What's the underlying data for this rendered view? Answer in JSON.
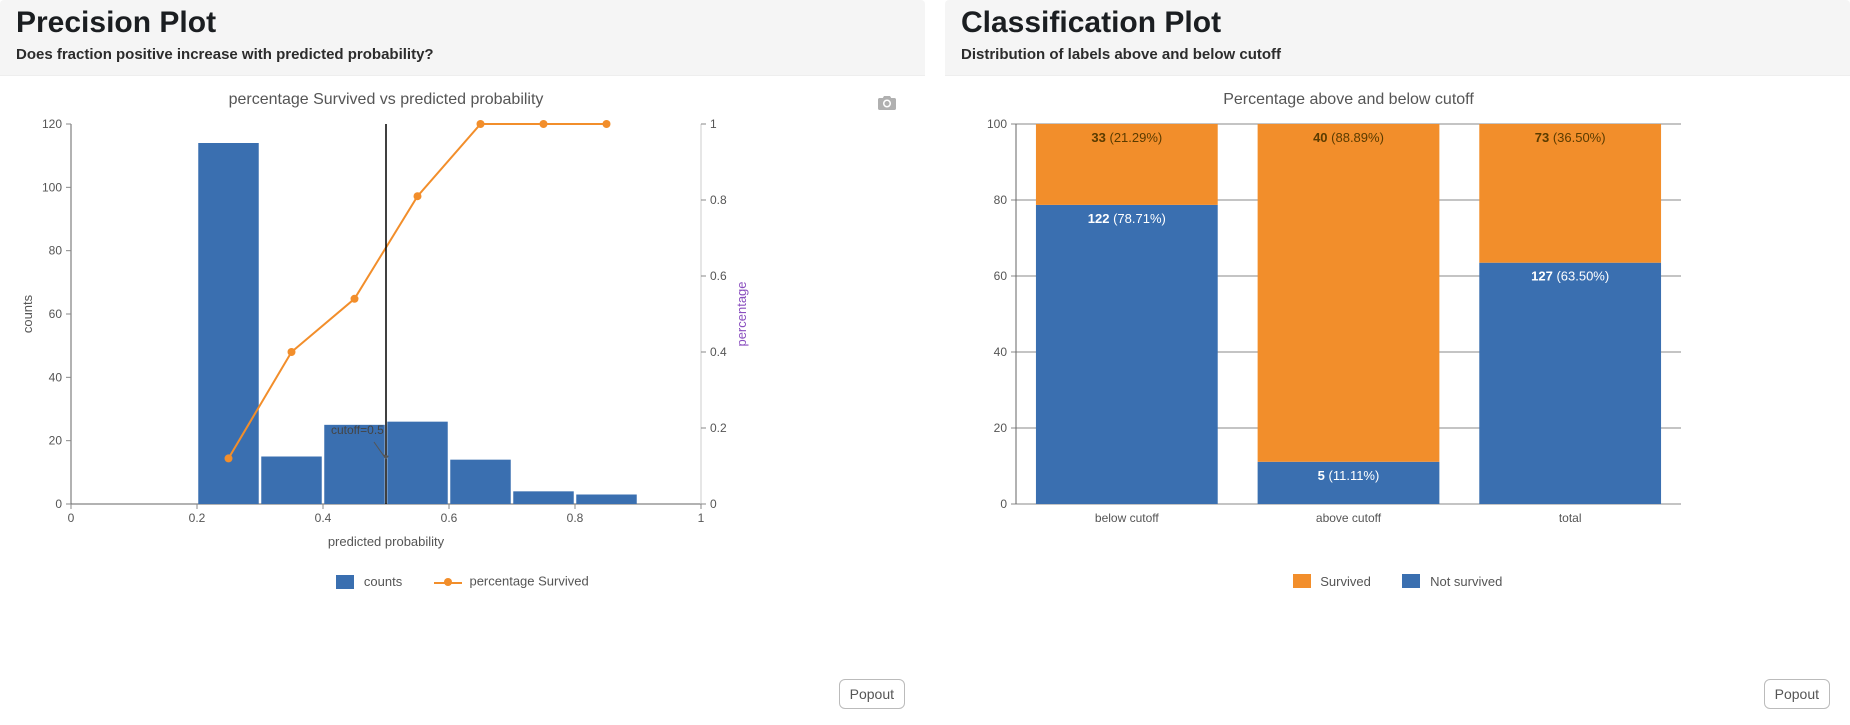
{
  "left_panel": {
    "title": "Precision Plot",
    "subtitle": "Does fraction positive increase with predicted probability?",
    "chart_title": "percentage Survived vs predicted probability",
    "xlabel": "predicted probability",
    "ylabel": "counts",
    "y2label": "percentage",
    "legend": {
      "bars": "counts",
      "line": "percentage Survived"
    },
    "cutoff_label": "cutoff=0.5",
    "popout": "Popout"
  },
  "right_panel": {
    "title": "Classification Plot",
    "subtitle": "Distribution of labels above and below cutoff",
    "chart_title": "Percentage above and below cutoff",
    "legend": {
      "top": "Survived",
      "bot": "Not survived"
    },
    "popout": "Popout"
  },
  "chart_data": [
    {
      "id": "precision",
      "type": "bar+line",
      "title": "percentage Survived vs predicted probability",
      "xlabel": "predicted probability",
      "ylabel_left": "counts",
      "ylabel_right": "percentage",
      "x_axis": {
        "min": 0.0,
        "max": 1.0,
        "ticks": [
          0,
          0.2,
          0.4,
          0.6,
          0.8,
          1
        ]
      },
      "y_axis_left": {
        "min": 0,
        "max": 120,
        "ticks": [
          0,
          20,
          40,
          60,
          80,
          100,
          120
        ]
      },
      "y_axis_right": {
        "min": 0,
        "max": 1,
        "ticks": [
          0,
          0.2,
          0.4,
          0.6,
          0.8,
          1
        ]
      },
      "bars": {
        "name": "counts",
        "bin_edges": [
          0.2,
          0.3,
          0.4,
          0.5,
          0.6,
          0.7,
          0.8,
          0.9
        ],
        "values": [
          114,
          15,
          25,
          26,
          14,
          4,
          3
        ]
      },
      "line": {
        "name": "percentage Survived",
        "x": [
          0.25,
          0.35,
          0.45,
          0.55,
          0.65,
          0.75,
          0.85
        ],
        "y": [
          0.12,
          0.4,
          0.54,
          0.81,
          1.0,
          1.0,
          1.0
        ]
      },
      "cutoff": {
        "x": 0.5,
        "label": "cutoff=0.5"
      }
    },
    {
      "id": "classification",
      "type": "stacked-bar",
      "title": "Percentage above and below cutoff",
      "categories": [
        "below cutoff",
        "above cutoff",
        "total"
      ],
      "y_axis": {
        "min": 0,
        "max": 100,
        "ticks": [
          0,
          20,
          40,
          60,
          80,
          100
        ]
      },
      "series_order": [
        "bottom",
        "top"
      ],
      "series": [
        {
          "name": "Not survived",
          "role": "bottom",
          "color": "#3a6fb0",
          "values_pct": [
            78.71,
            11.11,
            63.5
          ],
          "values_count": [
            122,
            5,
            127
          ]
        },
        {
          "name": "Survived",
          "role": "top",
          "color": "#f28e2b",
          "values_pct": [
            21.29,
            88.89,
            36.5
          ],
          "values_count": [
            33,
            40,
            73
          ]
        }
      ]
    }
  ]
}
